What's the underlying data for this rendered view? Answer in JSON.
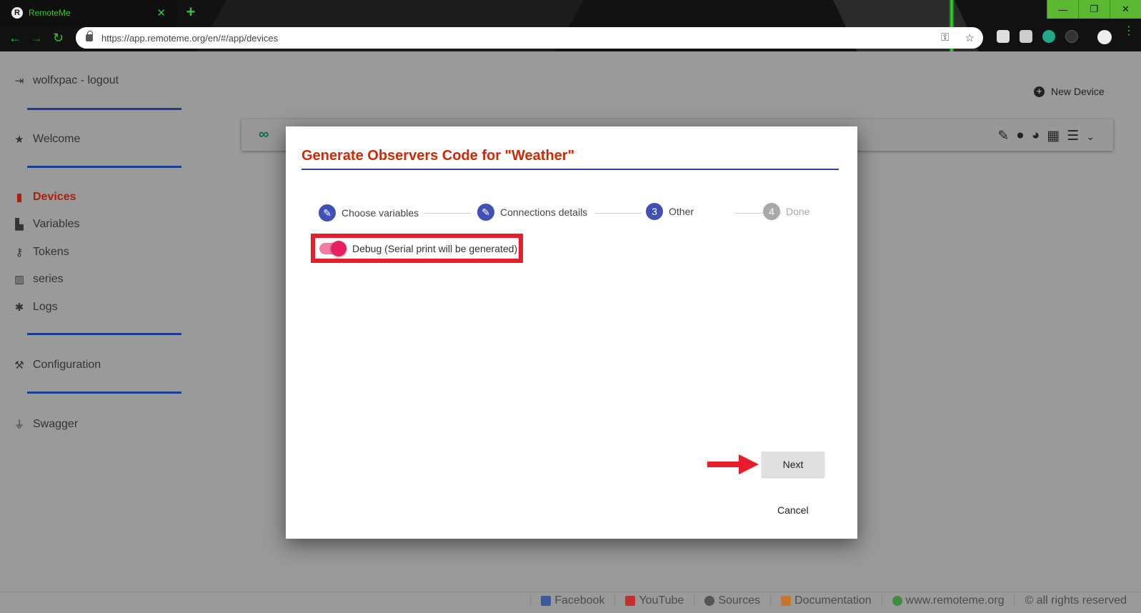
{
  "browser": {
    "tab_title": "RemoteMe",
    "url": "https://app.remoteme.org/en/#/app/devices"
  },
  "sidebar": {
    "user": "wolfxpac - logout",
    "items": [
      {
        "label": "Welcome"
      },
      {
        "label": "Devices"
      },
      {
        "label": "Variables"
      },
      {
        "label": "Tokens"
      },
      {
        "label": "series"
      },
      {
        "label": "Logs"
      },
      {
        "label": "Configuration"
      },
      {
        "label": "Swagger"
      }
    ]
  },
  "main": {
    "new_device_label": "New Device"
  },
  "modal": {
    "title": "Generate Observers Code for \"Weather\"",
    "steps": [
      {
        "number": "",
        "label": "Choose variables",
        "state": "completed"
      },
      {
        "number": "",
        "label": "Connections details",
        "state": "completed"
      },
      {
        "number": "3",
        "label": "Other",
        "state": "active"
      },
      {
        "number": "4",
        "label": "Done",
        "state": "disabled"
      }
    ],
    "debug_label": "Debug (Serial print will be generated)",
    "debug_enabled": true,
    "next_label": "Next",
    "cancel_label": "Cancel"
  },
  "footer": {
    "links": [
      {
        "label": "Facebook",
        "color": "#3b5998"
      },
      {
        "label": "YouTube",
        "color": "#c4302b"
      },
      {
        "label": "Sources",
        "color": "#555555"
      },
      {
        "label": "Documentation",
        "color": "#c8742a"
      },
      {
        "label": "www.remoteme.org",
        "color": "#3d8f3d"
      },
      {
        "label": "© all rights reserved",
        "color": ""
      }
    ]
  },
  "colors": {
    "accent": "#3f51b5",
    "title_red": "#cf2a08",
    "highlight_red": "#e81c2a",
    "toggle_pink": "#e91e63",
    "browser_green": "#2ec82e"
  }
}
